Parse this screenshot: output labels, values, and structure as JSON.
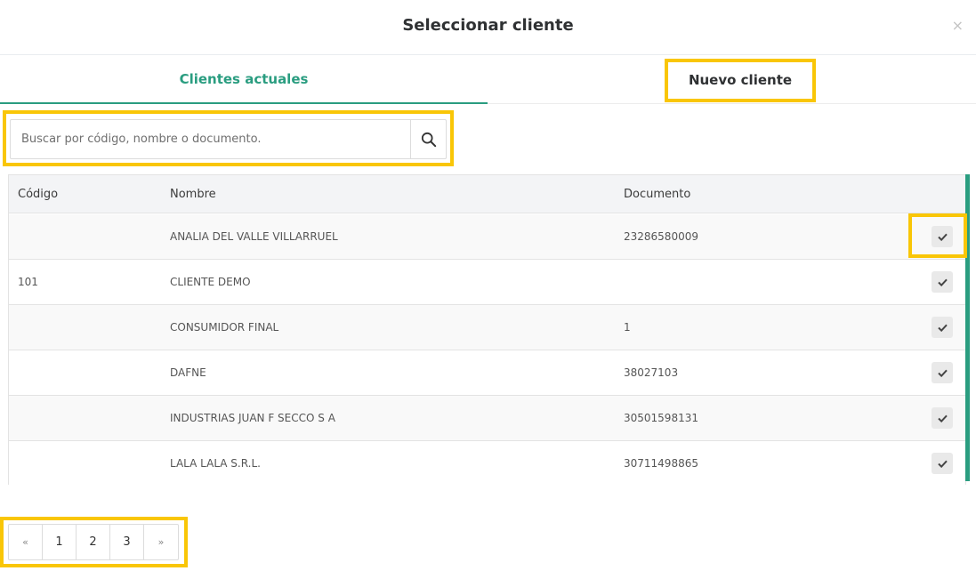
{
  "modal": {
    "title": "Seleccionar cliente",
    "close_symbol": "×"
  },
  "tabs": {
    "current_label": "Clientes actuales",
    "new_label": "Nuevo cliente"
  },
  "search": {
    "placeholder": "Buscar por código, nombre o documento.",
    "value": "",
    "icon": "search-icon"
  },
  "table": {
    "headers": {
      "code": "Código",
      "name": "Nombre",
      "document": "Documento"
    },
    "rows": [
      {
        "code": "",
        "name": "ANALIA DEL VALLE VILLARRUEL",
        "document": "23286580009"
      },
      {
        "code": "101",
        "name": "CLIENTE DEMO",
        "document": ""
      },
      {
        "code": "",
        "name": "CONSUMIDOR FINAL",
        "document": "1"
      },
      {
        "code": "",
        "name": "DAFNE",
        "document": "38027103"
      },
      {
        "code": "",
        "name": "INDUSTRIAS JUAN F SECCO S A",
        "document": "30501598131"
      },
      {
        "code": "",
        "name": "LALA LALA S.R.L.",
        "document": "30711498865"
      }
    ],
    "select_icon": "check-icon"
  },
  "pagination": {
    "prev": "«",
    "pages": [
      "1",
      "2",
      "3"
    ],
    "next": "»"
  },
  "colors": {
    "accent": "#2a9d80",
    "highlight": "#f9c607"
  }
}
